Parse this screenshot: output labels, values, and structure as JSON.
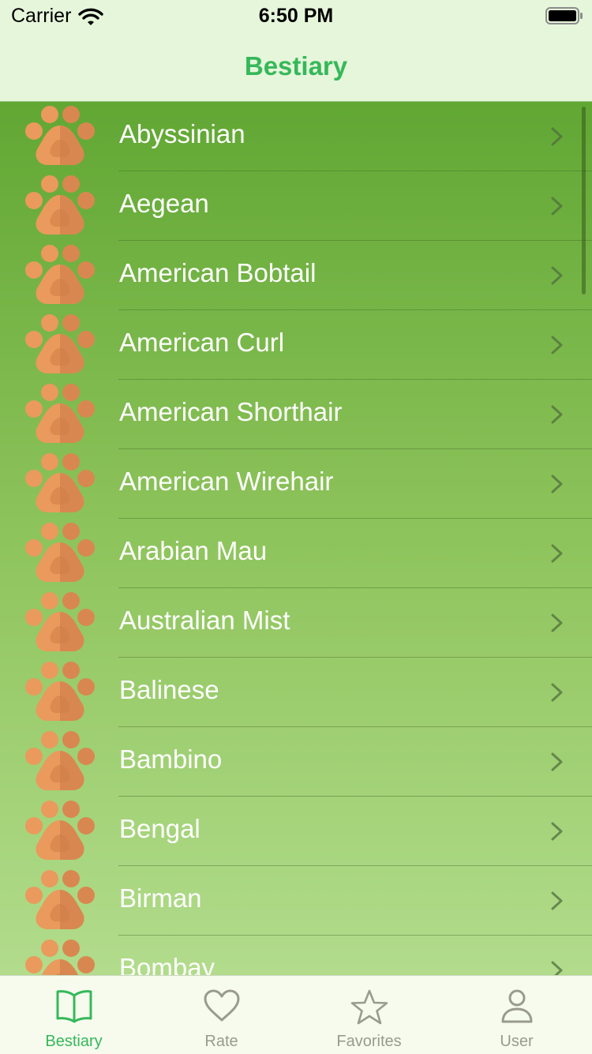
{
  "status_bar": {
    "carrier": "Carrier",
    "time": "6:50 PM"
  },
  "nav": {
    "title": "Bestiary"
  },
  "colors": {
    "accent": "#35b85a",
    "tab_inactive": "#9a9a8e",
    "paw_light": "#ea9a5c",
    "paw_dark": "#d98750"
  },
  "breeds": [
    {
      "name": "Abyssinian",
      "icon": "paw-icon"
    },
    {
      "name": "Aegean",
      "icon": "paw-icon"
    },
    {
      "name": "American Bobtail",
      "icon": "paw-icon"
    },
    {
      "name": "American Curl",
      "icon": "paw-icon"
    },
    {
      "name": "American Shorthair",
      "icon": "paw-icon"
    },
    {
      "name": "American Wirehair",
      "icon": "paw-icon"
    },
    {
      "name": "Arabian Mau",
      "icon": "paw-icon"
    },
    {
      "name": "Australian Mist",
      "icon": "paw-icon"
    },
    {
      "name": "Balinese",
      "icon": "paw-icon"
    },
    {
      "name": "Bambino",
      "icon": "paw-icon"
    },
    {
      "name": "Bengal",
      "icon": "paw-icon"
    },
    {
      "name": "Birman",
      "icon": "paw-icon"
    },
    {
      "name": "Bombay",
      "icon": "paw-icon"
    }
  ],
  "tabs": [
    {
      "label": "Bestiary",
      "icon": "book-icon",
      "selected": true
    },
    {
      "label": "Rate",
      "icon": "heart-icon",
      "selected": false
    },
    {
      "label": "Favorites",
      "icon": "star-icon",
      "selected": false
    },
    {
      "label": "User",
      "icon": "person-icon",
      "selected": false
    }
  ]
}
